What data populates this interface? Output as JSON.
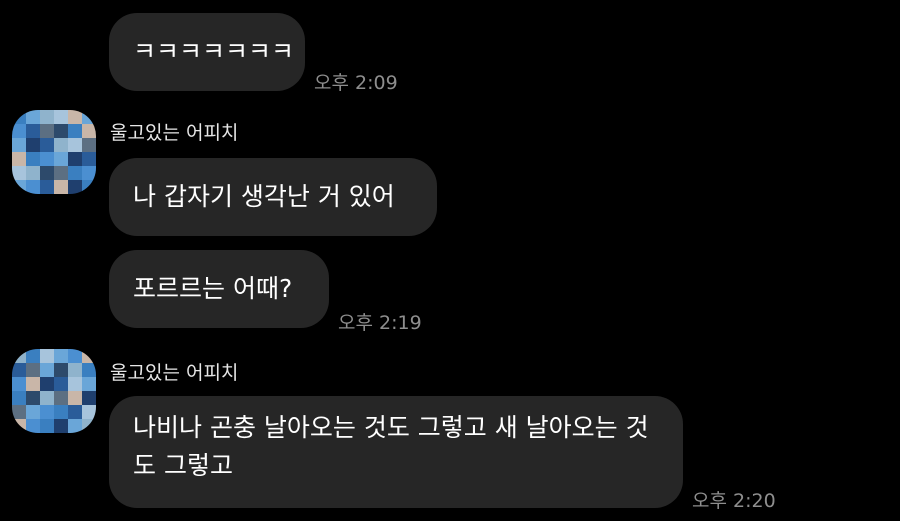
{
  "messages": [
    {
      "text": "ㅋㅋㅋㅋㅋㅋㅋ",
      "time": "오후 2:09"
    },
    {
      "sender": "울고있는 어피치",
      "text": "나 갑자기 생각난 거 있어"
    },
    {
      "text": "포르르는 어때?",
      "time": "오후 2:19"
    },
    {
      "sender": "울고있는 어피치",
      "text": "나비나 곤충 날아오는 것도 그렇고 새 날아오는 것도 그렇고",
      "time": "오후 2:20"
    }
  ],
  "colors": {
    "background": "#000000",
    "bubble": "#262626",
    "text": "#ffffff",
    "timestamp": "#8e8e8e"
  },
  "avatar": {
    "icon": "pixelated-profile-avatar",
    "palette": [
      "#3a7fc0",
      "#6aa6d8",
      "#2a5c99",
      "#8fb3cc",
      "#c9b6a8",
      "#5c6f82",
      "#1f3f6e",
      "#4b8fd1",
      "#a7c4dc",
      "#2d4a6b",
      "#7a9bb5",
      "#b89f90"
    ]
  }
}
